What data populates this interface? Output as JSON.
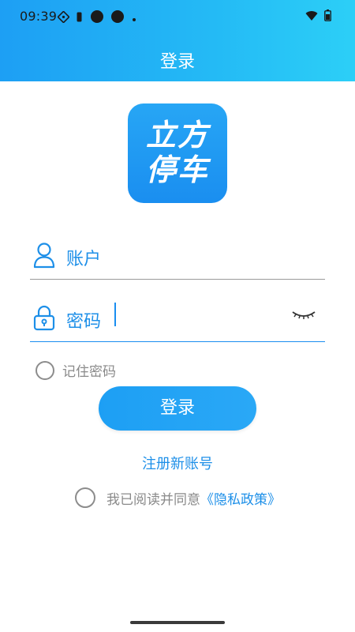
{
  "status_bar": {
    "time": "09:39",
    "left_icons": [
      "diamond-notification-icon",
      "sim-card-icon",
      "circle-notification-icon",
      "circle-notification-icon",
      "dot-icon"
    ],
    "right_icons": [
      "wifi-icon",
      "battery-icon"
    ]
  },
  "header": {
    "title": "登录",
    "gradient_start": "#1d9ff4",
    "gradient_end": "#2ccff7"
  },
  "logo": {
    "line1": "立方",
    "line2": "停车",
    "background": "#1a8ef0"
  },
  "form": {
    "account": {
      "icon": "user-icon",
      "placeholder": "账户",
      "value": ""
    },
    "password": {
      "icon": "lock-icon",
      "placeholder": "密码",
      "value": "",
      "toggle_icon": "eye-closed-icon"
    },
    "remember": {
      "label": "记住密码",
      "checked": false
    },
    "login_button": "登录"
  },
  "register_link": "注册新账号",
  "agreement": {
    "text": "我已阅读并同意",
    "policy_link": "《隐私政策》",
    "checked": false
  },
  "colors": {
    "accent": "#1d8fe8",
    "muted_text": "#8a8a8a",
    "divider": "#9a9a9a"
  }
}
